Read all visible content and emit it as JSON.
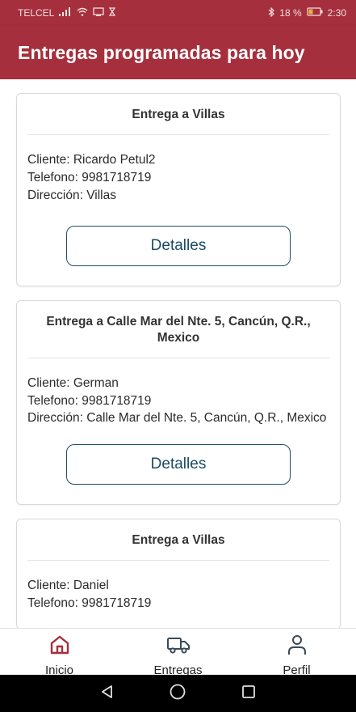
{
  "status_bar": {
    "carrier": "TELCEL",
    "battery": "18 %",
    "time": "2:30"
  },
  "header": {
    "title": "Entregas programadas para hoy"
  },
  "deliveries": [
    {
      "title": "Entrega a Villas",
      "client": "Cliente: Ricardo Petul2",
      "phone": "Telefono: 9981718719",
      "address": "Dirección: Villas",
      "button": "Detalles"
    },
    {
      "title": "Entrega a Calle Mar del Nte. 5, Cancún, Q.R., Mexico",
      "client": "Cliente: German",
      "phone": "Telefono: 9981718719",
      "address": "Dirección: Calle Mar del Nte. 5, Cancún, Q.R., Mexico",
      "button": "Detalles"
    },
    {
      "title": "Entrega a Villas",
      "client": "Cliente: Daniel",
      "phone": "Telefono: 9981718719",
      "address": "",
      "button": ""
    }
  ],
  "bottom_nav": {
    "items": [
      {
        "label": "Inicio",
        "icon": "home-icon",
        "active": true
      },
      {
        "label": "Entregas",
        "icon": "truck-icon",
        "active": false
      },
      {
        "label": "Perfil",
        "icon": "person-icon",
        "active": false
      }
    ]
  },
  "colors": {
    "primary": "#a52f3c",
    "button_border": "#1f4e66",
    "active_icon": "#a52f3c"
  }
}
